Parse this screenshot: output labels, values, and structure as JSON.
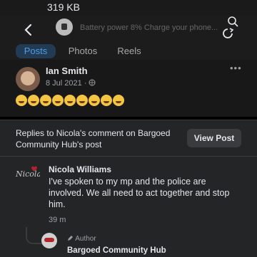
{
  "status_bar": {
    "download_size": "319 KB"
  },
  "top_bar": {
    "ghost_notification": "Battery power 8%  Charge your phone..."
  },
  "tabs": [
    {
      "label": "Posts",
      "active": true
    },
    {
      "label": "Photos",
      "active": false
    },
    {
      "label": "Reels",
      "active": false
    }
  ],
  "post": {
    "author": "Ian Smith",
    "date": "8 Jul 2021 ·",
    "more": "•••",
    "reaction_emoji": "laughing-face",
    "reaction_count": 9
  },
  "reply_panel": {
    "header": "Replies to Nicola's comment on Bargoed Community Hub's post",
    "view_post_label": "View Post",
    "comment": {
      "author": "Nicola Williams",
      "avatar_text": "Nicola",
      "text": "I've spoken to my mp and the police are involved. We all need to act together and stop him.",
      "time": "39 m"
    },
    "reply": {
      "badge": "Author",
      "author": "Bargoed Community Hub"
    }
  },
  "colors": {
    "accent": "#4e9eea",
    "panel": "#242526",
    "background": "#000000"
  }
}
